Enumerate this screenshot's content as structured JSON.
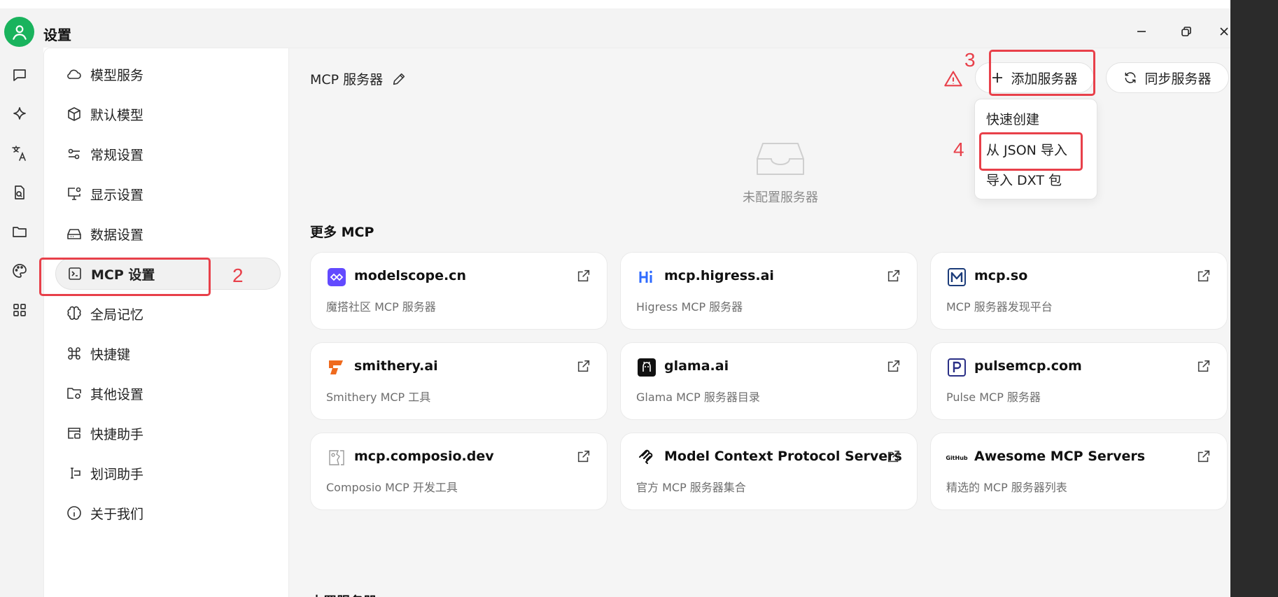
{
  "window": {
    "title": "设置"
  },
  "colors": {
    "accent": "#19b35d",
    "annotation": "#e8404a",
    "warning": "#e8404a"
  },
  "settings_nav": {
    "items": [
      {
        "label": "模型服务",
        "icon": "cloud-icon"
      },
      {
        "label": "默认模型",
        "icon": "cube-icon"
      },
      {
        "label": "常规设置",
        "icon": "sliders-icon"
      },
      {
        "label": "显示设置",
        "icon": "monitor-settings-icon"
      },
      {
        "label": "数据设置",
        "icon": "hard-drive-icon"
      },
      {
        "label": "MCP 设置",
        "icon": "terminal-icon",
        "active": true
      },
      {
        "label": "全局记忆",
        "icon": "brain-icon"
      },
      {
        "label": "快捷键",
        "icon": "command-icon"
      },
      {
        "label": "其他设置",
        "icon": "folder-settings-icon"
      },
      {
        "label": "快捷助手",
        "icon": "app-window-icon"
      },
      {
        "label": "划词助手",
        "icon": "text-cursor-icon"
      },
      {
        "label": "关于我们",
        "icon": "info-icon"
      }
    ]
  },
  "main": {
    "title": "MCP 服务器",
    "add_button": "添加服务器",
    "sync_button": "同步服务器",
    "dropdown": [
      "快速创建",
      "从 JSON 导入",
      "导入 DXT 包"
    ],
    "empty_label": "未配置服务器",
    "more_title": "更多 MCP",
    "builtin_title": "内置服务器",
    "cards": [
      {
        "name": "modelscope.cn",
        "desc": "魔搭社区 MCP 服务器",
        "icon": "modelscope-logo-icon"
      },
      {
        "name": "mcp.higress.ai",
        "desc": "Higress MCP 服务器",
        "icon": "higress-logo-icon"
      },
      {
        "name": "mcp.so",
        "desc": "MCP 服务器发现平台",
        "icon": "mcp-so-logo-icon"
      },
      {
        "name": "smithery.ai",
        "desc": "Smithery MCP 工具",
        "icon": "smithery-logo-icon"
      },
      {
        "name": "glama.ai",
        "desc": "Glama MCP 服务器目录",
        "icon": "glama-logo-icon"
      },
      {
        "name": "pulsemcp.com",
        "desc": "Pulse MCP 服务器",
        "icon": "pulsemcp-logo-icon"
      },
      {
        "name": "mcp.composio.dev",
        "desc": "Composio MCP 开发工具",
        "icon": "broken-image-icon"
      },
      {
        "name": "Model Context Protocol Servers",
        "desc": "官方 MCP 服务器集合",
        "icon": "mcp-logo-icon"
      },
      {
        "name": "Awesome MCP Servers",
        "desc": "精选的 MCP 服务器列表",
        "icon": "github-logo-icon",
        "logo_text": "GitHub"
      }
    ]
  },
  "annotations": [
    "2",
    "3",
    "4"
  ]
}
